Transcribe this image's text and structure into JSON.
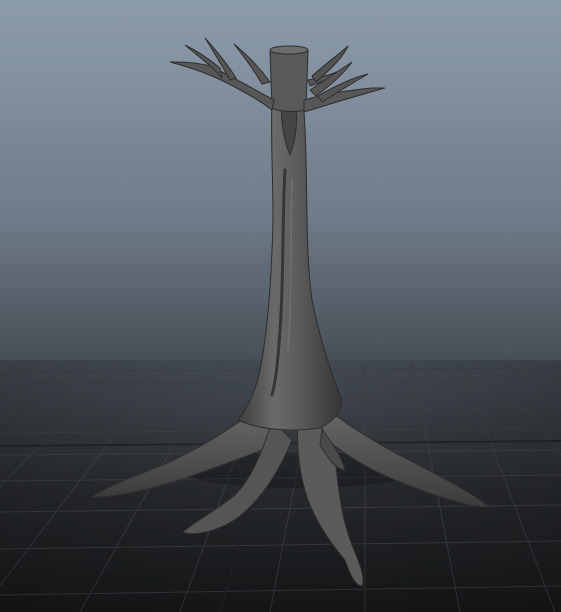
{
  "viewport": {
    "background_top_color": "#8c9bab",
    "background_mid_color": "#5b6570",
    "background_bottom_color": "#1c1e20",
    "grid_color": "#3c4045",
    "grid_axis_color": "#24272a"
  },
  "model": {
    "icon": "tree-mesh-icon",
    "surface_color": "#5e5e5e",
    "shadow_color": "#3b3b3b",
    "highlight_color": "#7a7a7a"
  }
}
